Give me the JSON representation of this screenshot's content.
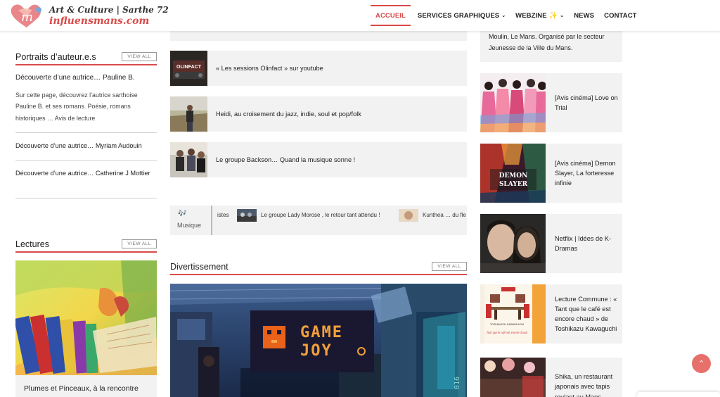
{
  "header": {
    "brand_line1": "Art & Culture | Sarthe 72",
    "brand_line2": "influensmans.com",
    "nav": [
      {
        "label": "ACCUEIL",
        "active": true
      },
      {
        "label": "SERVICES GRAPHIQUES",
        "has_dropdown": true
      },
      {
        "label": "WEBZINE",
        "has_dropdown": true,
        "icon": "sparkle-icon"
      },
      {
        "label": "NEWS"
      },
      {
        "label": "CONTACT"
      }
    ]
  },
  "left": {
    "portraits": {
      "title": "Portraits d’auteur.e.s",
      "view_all": "VIEW ALL",
      "featured_title": "Découverte d’une autrice… Pauline B.",
      "featured_excerpt": "Sur cette page, découvrez l’autrice sarthoise Pauline B. et ses romans. Poésie, romans historiques … Avis de lecture",
      "items": [
        "Découverte d’une autrice… Myriam Audouin",
        "Découverte d’une autrice… Catherine J Mottier"
      ]
    },
    "lectures": {
      "title": "Lectures",
      "view_all": "VIEW ALL",
      "caption": "Plumes et Pinceaux, à la rencontre"
    }
  },
  "middle": {
    "cards": [
      {
        "title": "« Les sessions Olinfact » sur youtube",
        "thumb_text": "OLINFACT"
      },
      {
        "title": "Heidi, au croisement du jazz, indie, soul et pop/folk"
      },
      {
        "title": "Le groupe Backson… Quand la musique sonne !"
      }
    ],
    "ticker": {
      "label": "Musique",
      "icon": "music-sparkle-icon",
      "items": [
        "istes",
        "Le groupe Lady Morose , le retour tant attendu !",
        "Kunthea … du fle"
      ]
    },
    "divertissement": {
      "title": "Divertissement",
      "view_all": "VIEW ALL",
      "image_sign": "GAME JOY"
    }
  },
  "right": {
    "top_text": "Moulin, Le Mans. Organisé par le secteur Jeunesse de la Ville du Mans.",
    "cards": [
      {
        "title": "[Avis cinéma] Love on Trial"
      },
      {
        "title": "[Avis cinéma] Demon Slayer, La forteresse infinie"
      },
      {
        "title": "Netflix | Idées de K-Dramas"
      },
      {
        "title": "Lecture Commune : « Tant que le café est encore chaud » de Toshikazu Kawaguchi"
      },
      {
        "title": "Shika, un restaurant japonais avec tapis roulant au Mans"
      }
    ],
    "book_cover": {
      "author": "TOSHIKAZU KAWAGUCHI",
      "title": "Tant que le café est encore chaud"
    },
    "demon_slayer_logo": "DEMON SLAYER"
  },
  "colors": {
    "accent": "#d94b4b",
    "card_bg": "#f2f2f2",
    "scroll_button": "#e8706a"
  }
}
